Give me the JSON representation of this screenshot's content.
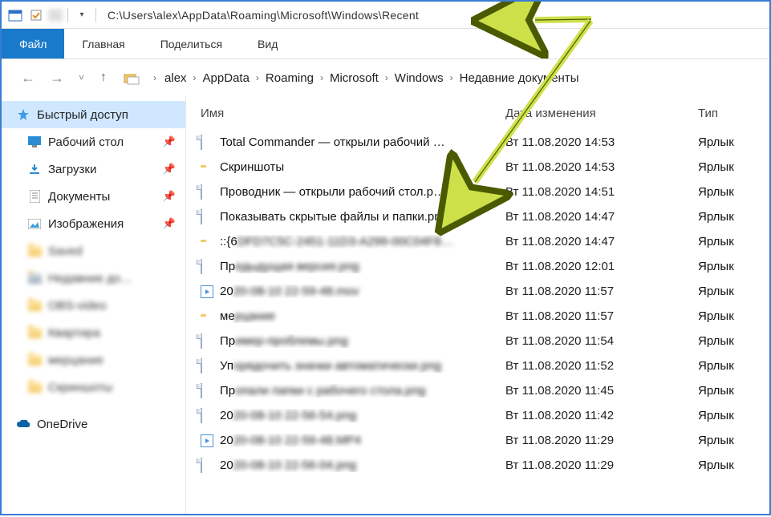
{
  "titlebar": {
    "path": "C:\\Users\\alex\\AppData\\Roaming\\Microsoft\\Windows\\Recent"
  },
  "ribbon": {
    "file": "Файл",
    "home": "Главная",
    "share": "Поделиться",
    "view": "Вид"
  },
  "breadcrumb": {
    "items": [
      "alex",
      "AppData",
      "Roaming",
      "Microsoft",
      "Windows",
      "Недавние документы"
    ]
  },
  "columns": {
    "name": "Имя",
    "date": "Дата изменения",
    "type": "Тип"
  },
  "sidebar": {
    "quick_access": "Быстрый доступ",
    "desktop": "Рабочий стол",
    "downloads": "Загрузки",
    "documents": "Документы",
    "pictures": "Изображения",
    "onedrive": "OneDrive",
    "b1": "Saved",
    "b2": "Недавние до…",
    "b3": "OBS-video",
    "b4": "Квартира",
    "b5": "мерцание",
    "b6": "Скриншоты"
  },
  "files": [
    {
      "icon": "img",
      "name": "Total Commander — открыли рабочий …",
      "date": "Вт 11.08.2020 14:53",
      "type": "Ярлык"
    },
    {
      "icon": "folder",
      "name": "Скриншоты",
      "date": "Вт 11.08.2020 14:53",
      "type": "Ярлык"
    },
    {
      "icon": "img",
      "name": "Проводник — открыли рабочий стол.p…",
      "date": "Вт 11.08.2020 14:51",
      "type": "Ярлык"
    },
    {
      "icon": "img",
      "name": "Показывать скрытые файлы и папки.png",
      "date": "Вт 11.08.2020 14:47",
      "type": "Ярлык"
    },
    {
      "icon": "folder",
      "name_prefix": "::{6",
      "name_blur": "DFD7C5C-2451-11D3-A299-00C04F8…",
      "date": "Вт 11.08.2020 14:47",
      "type": "Ярлык"
    },
    {
      "icon": "img",
      "name_prefix": "Пр",
      "name_blur": "едыдущая версия.png",
      "date": "Вт 11.08.2020 12:01",
      "type": "Ярлык"
    },
    {
      "icon": "video",
      "name_prefix": "20",
      "name_blur": "20-08-10 22-59-48.mov",
      "date": "Вт 11.08.2020 11:57",
      "type": "Ярлык"
    },
    {
      "icon": "folder",
      "name_prefix": "ме",
      "name_blur": "рцание",
      "date": "Вт 11.08.2020 11:57",
      "type": "Ярлык"
    },
    {
      "icon": "img",
      "name_prefix": "Пр",
      "name_blur": "имер-проблемы.png",
      "date": "Вт 11.08.2020 11:54",
      "type": "Ярлык"
    },
    {
      "icon": "img",
      "name_prefix": "Уп",
      "name_blur": "орядочить значки автоматически.png",
      "date": "Вт 11.08.2020 11:52",
      "type": "Ярлык"
    },
    {
      "icon": "img",
      "name_prefix": "Пр",
      "name_blur": "опали папки с рабочего стола.png",
      "date": "Вт 11.08.2020 11:45",
      "type": "Ярлык"
    },
    {
      "icon": "img",
      "name_prefix": "20",
      "name_blur": "20-08-10 22-56-54.png",
      "date": "Вт 11.08.2020 11:42",
      "type": "Ярлык"
    },
    {
      "icon": "video",
      "name_prefix": "20",
      "name_blur": "20-08-10 22-59-48.MP4",
      "date": "Вт 11.08.2020 11:29",
      "type": "Ярлык"
    },
    {
      "icon": "img",
      "name_prefix": "20",
      "name_blur": "20-08-10 22-56-04.png",
      "date": "Вт 11.08.2020 11:29",
      "type": "Ярлык"
    }
  ]
}
